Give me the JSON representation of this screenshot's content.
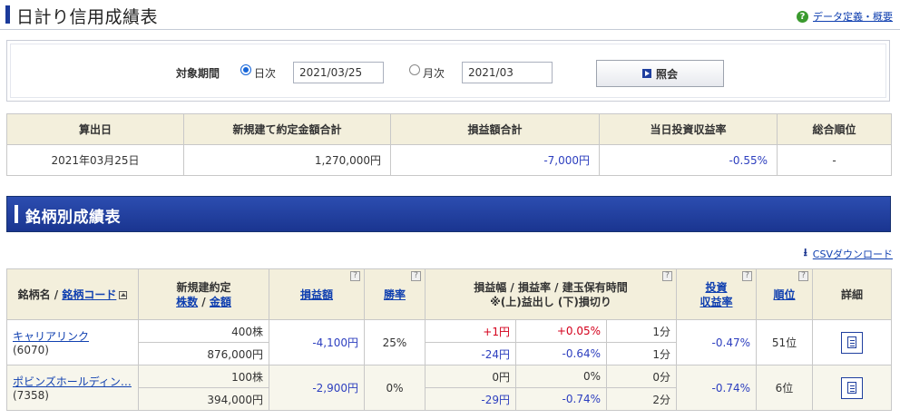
{
  "header": {
    "title": "日計り信用成績表",
    "help_link": "データ定義・概要"
  },
  "search": {
    "period_label": "対象期間",
    "daily_label": "日次",
    "daily_value": "2021/03/25",
    "monthly_label": "月次",
    "monthly_value": "2021/03",
    "query_button": "照会"
  },
  "summary": {
    "headers": [
      "算出日",
      "新規建て約定金額合計",
      "損益額合計",
      "当日投資収益率",
      "総合順位"
    ],
    "row": {
      "date": "2021年03月25日",
      "total_amount": "1,270,000円",
      "pnl_total": "-7,000円",
      "return_rate": "-0.55%",
      "rank": "-"
    }
  },
  "section": {
    "title": "銘柄別成績表",
    "csv_link": "CSVダウンロード"
  },
  "detail": {
    "headers": {
      "name": "銘柄名 / ",
      "code": "銘柄コード",
      "new_contract": "新規建約定",
      "shares": "株数",
      "sep": " / ",
      "amount": "金額",
      "pnl": "損益額",
      "win_rate": "勝率",
      "range_line1": "損益幅 / 損益率 / 建玉保有時間",
      "range_line2": "※(上)益出し (下)損切り",
      "invest1": "投資",
      "invest2": "収益率",
      "rank": "順位",
      "detail": "詳細"
    },
    "rows": [
      {
        "name": "キャリアリンク",
        "code": "(6070)",
        "shares": "400株",
        "amount": "876,000円",
        "pnl": "-4,100円",
        "win_rate": "25%",
        "up_range": "+1円",
        "up_rate": "+0.05%",
        "up_time": "1分",
        "down_range": "-24円",
        "down_rate": "-0.64%",
        "down_time": "1分",
        "return_rate": "-0.47%",
        "rank": "51位"
      },
      {
        "name": "ポビンズホールディン…",
        "code": "(7358)",
        "shares": "100株",
        "amount": "394,000円",
        "pnl": "-2,900円",
        "win_rate": "0%",
        "up_range": "0円",
        "up_rate": "0%",
        "up_time": "0分",
        "down_range": "-29円",
        "down_rate": "-0.74%",
        "down_time": "2分",
        "return_rate": "-0.74%",
        "rank": "6位"
      }
    ]
  },
  "icons": {
    "help": "help-icon",
    "download": "download-icon",
    "detail": "detail-document-icon",
    "question": "question-icon"
  },
  "colors": {
    "accent_blue": "#1b3a9a",
    "negative_blue": "#2d3fbf",
    "positive_red": "#d4001c",
    "header_bg": "#f3efdc"
  }
}
